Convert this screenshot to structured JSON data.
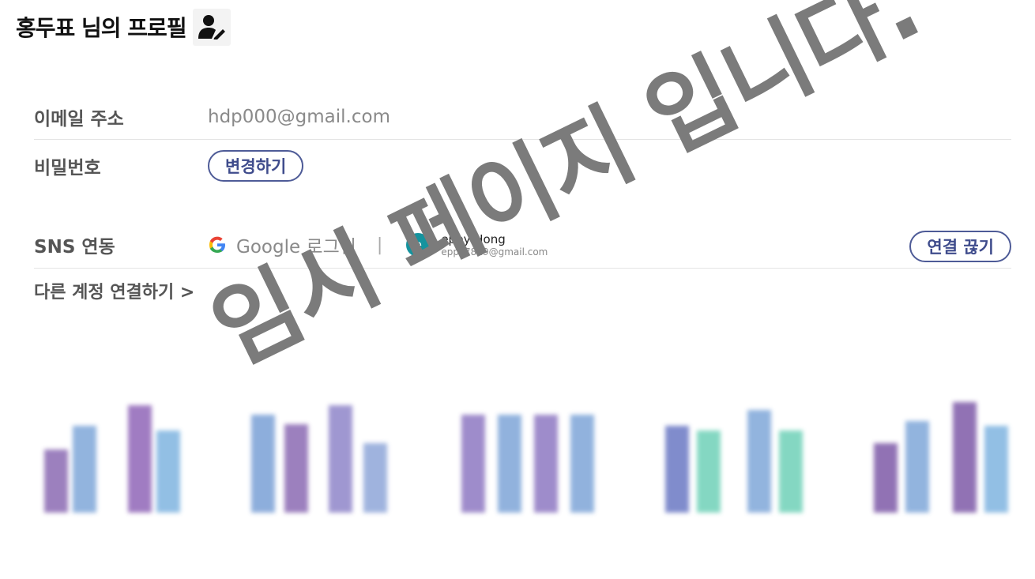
{
  "header": {
    "title": "홍두표 님의 프로필",
    "edit_icon": "user-edit-icon"
  },
  "email": {
    "label": "이메일 주소",
    "value": "hdp000@gmail.com"
  },
  "password": {
    "label": "비밀번호",
    "change_button": "변경하기"
  },
  "sns": {
    "label": "SNS 연동",
    "provider_icon": "google-icon",
    "provider": "Google 로그인",
    "separator": "|",
    "account": {
      "avatar_letter": "e",
      "name": "eppy Hong",
      "email": "eppy7819@gmail.com"
    },
    "disconnect_button": "연결 끊기"
  },
  "link_other": "다른 계정 연결하기 >",
  "watermark": "임시 페이지 입니다.",
  "colors": {
    "accent": "#4e5b97",
    "avatar": "#15939e",
    "watermark": "#7b7b7b"
  }
}
